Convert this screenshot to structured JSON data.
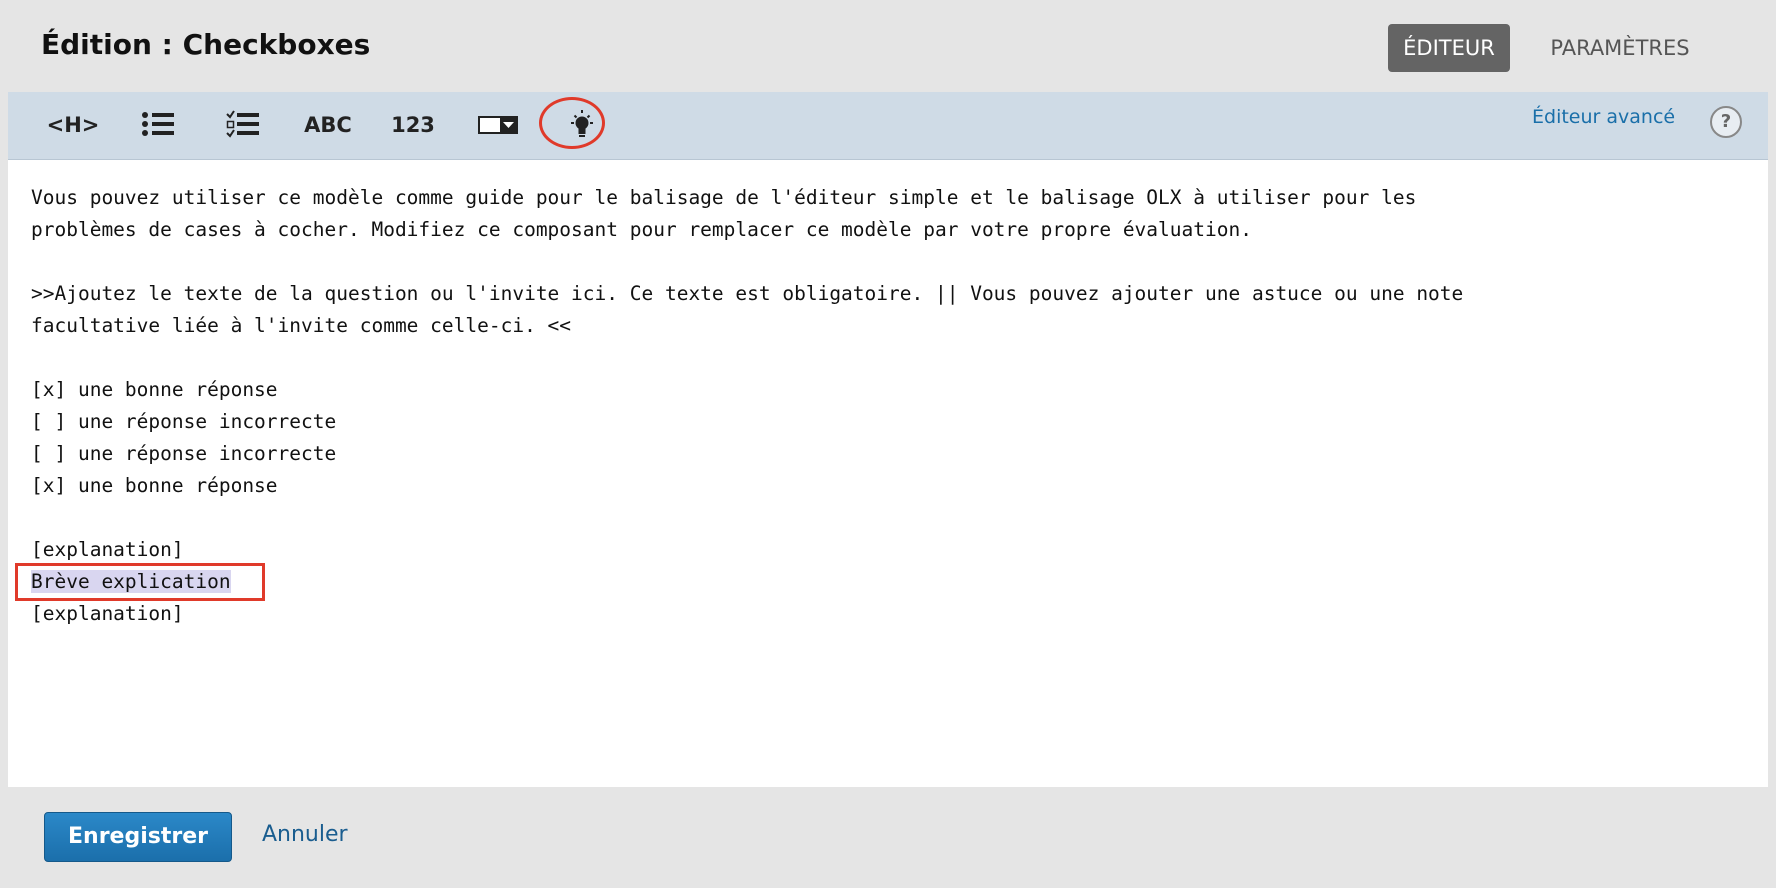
{
  "header": {
    "title": "Édition : Checkboxes",
    "tabs": [
      {
        "label": "ÉDITEUR",
        "active": true
      },
      {
        "label": "PARAMÈTRES",
        "active": false
      }
    ]
  },
  "toolbar": {
    "buttons": [
      {
        "name": "heading-button",
        "label": "<H>"
      },
      {
        "name": "multiple-choice-button",
        "icon": "bullet-list-icon"
      },
      {
        "name": "checkboxes-button",
        "icon": "checklist-icon"
      },
      {
        "name": "text-input-button",
        "label": "ABC"
      },
      {
        "name": "numerical-input-button",
        "label": "123"
      },
      {
        "name": "dropdown-button",
        "icon": "dropdown-icon"
      },
      {
        "name": "explanation-button",
        "icon": "lightbulb-icon"
      }
    ],
    "advanced_editor": "Éditeur avancé",
    "help": "?"
  },
  "editor": {
    "lines": [
      "Vous pouvez utiliser ce modèle comme guide pour le balisage de l'éditeur simple et le balisage OLX à utiliser pour les",
      "problèmes de cases à cocher. Modifiez ce composant pour remplacer ce modèle par votre propre évaluation.",
      "",
      ">>Ajoutez le texte de la question ou l'invite ici. Ce texte est obligatoire. || Vous pouvez ajouter une astuce ou une note",
      "facultative liée à l'invite comme celle-ci. <<",
      "",
      "[x] une bonne réponse",
      "[ ] une réponse incorrecte",
      "[ ] une réponse incorrecte",
      "[x] une bonne réponse",
      "",
      "[explanation]",
      "Brève explication",
      "[explanation]"
    ],
    "selected_line_index": 12
  },
  "footer": {
    "save": "Enregistrer",
    "cancel": "Annuler"
  },
  "colors": {
    "highlight": "#e03a2a",
    "primary": "#1b6fab",
    "link": "#1a6fa9"
  }
}
